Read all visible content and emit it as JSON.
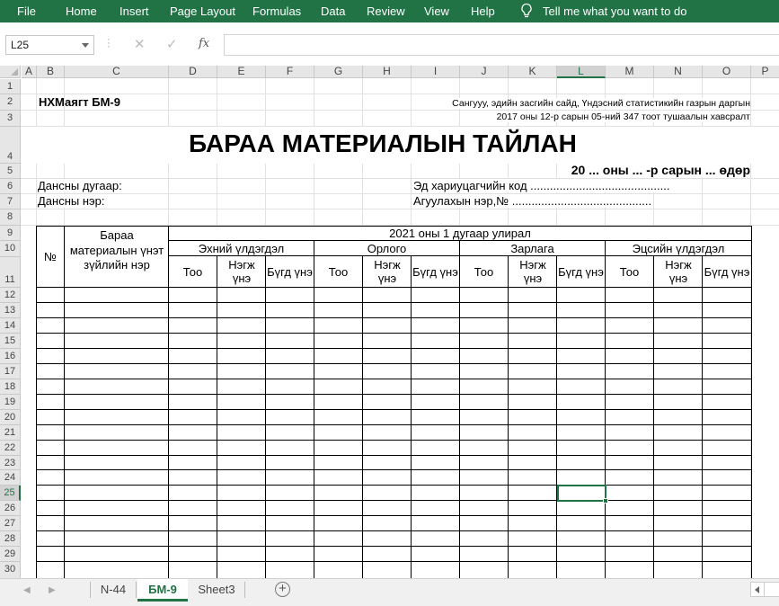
{
  "ribbon": {
    "tabs": [
      "File",
      "Home",
      "Insert",
      "Page Layout",
      "Formulas",
      "Data",
      "Review",
      "View",
      "Help"
    ],
    "tell_me": "Tell me what you want to do"
  },
  "formula_bar": {
    "name_box": "L25",
    "fx": "fx",
    "formula": ""
  },
  "columns": [
    "A",
    "B",
    "C",
    "D",
    "E",
    "F",
    "G",
    "H",
    "I",
    "J",
    "K",
    "L",
    "M",
    "N",
    "O",
    "P"
  ],
  "selected_column": "L",
  "rows": [
    "1",
    "2",
    "3",
    "4",
    "5",
    "6",
    "7",
    "8",
    "9",
    "10",
    "11",
    "12",
    "13",
    "14",
    "15",
    "16",
    "17",
    "18",
    "19",
    "20",
    "21",
    "22",
    "23",
    "24",
    "25",
    "26",
    "27",
    "28",
    "29",
    "30"
  ],
  "selected_row": "25",
  "sheet": {
    "form_code": "НХМаягт БМ-9",
    "approval_line1": "Сангууу, эдийн засгийн сайд, Үндэсний статистикийн газрын даргын",
    "approval_line2": "2017 оны 12-р сарын 05-ний 347 тоот тушаалын хавсралт",
    "title": "БАРАА МАТЕРИАЛЫН ТАЙЛАН",
    "date_line": "20 ...  оны ... -р сарын ...  өдөр",
    "account_number_label": "Дансны дугаар:",
    "account_name_label": "Дансны нэр:",
    "manager_code_label": "Эд хариуцагчийн код ...........................................",
    "warehouse_label": "Агуулахын нэр,№ ...........................................",
    "col_no": "№",
    "col_item": "Бараа материалын үнэт зүйлийн нэр",
    "period": "2021 оны 1  дугаар улирал",
    "groups": [
      "Эхний үлдэгдэл",
      "Орлого",
      "Зарлага",
      "Эцсийн үлдэгдэл"
    ],
    "sub_qty": "Тоо",
    "sub_unit": "Нэгж үнэ",
    "sub_total": "Бүгд үнэ"
  },
  "sheet_tabs": [
    "N-44",
    "БМ-9",
    "Sheet3"
  ],
  "active_sheet": "БМ-9"
}
